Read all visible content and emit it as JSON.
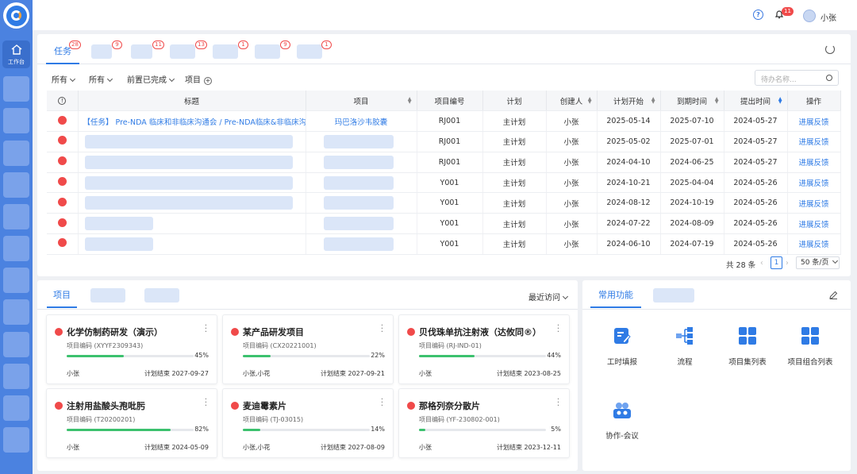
{
  "sidebar": {
    "home_label": "工作台",
    "placeholder_count": 13
  },
  "topbar": {
    "help_icon": "help-icon",
    "notification_count": "11",
    "user_name": "小张"
  },
  "tasks_panel": {
    "tabs": [
      {
        "label": "任务",
        "badge": "28"
      },
      {
        "label": "",
        "badge": "9"
      },
      {
        "label": "",
        "badge": "11"
      },
      {
        "label": "",
        "badge": "13"
      },
      {
        "label": "",
        "badge": "1"
      },
      {
        "label": "",
        "badge": "9"
      },
      {
        "label": "",
        "badge": "1"
      }
    ],
    "filters": [
      "所有",
      "所有",
      "前置已完成",
      "项目"
    ],
    "search_placeholder": "待办名称...",
    "columns": [
      "标题",
      "项目",
      "项目编号",
      "计划",
      "创建人",
      "计划开始",
      "到期时间",
      "提出时间",
      "操作"
    ],
    "rows": [
      {
        "title": "【任务】 Pre-NDA 临床和非临床沟通会 / Pre-NDA临床&非临床沟...",
        "project": "玛巴洛沙韦胶囊",
        "code": "RJ001",
        "plan": "主计划",
        "creator": "小张",
        "start": "2025-05-14",
        "due": "2025-07-10",
        "submitted": "2024-05-27",
        "action": "进展反馈"
      },
      {
        "title": "",
        "project": "",
        "code": "RJ001",
        "plan": "主计划",
        "creator": "小张",
        "start": "2025-05-02",
        "due": "2025-07-01",
        "submitted": "2024-05-27",
        "action": "进展反馈"
      },
      {
        "title": "",
        "project": "",
        "code": "RJ001",
        "plan": "主计划",
        "creator": "小张",
        "start": "2024-04-10",
        "due": "2024-06-25",
        "submitted": "2024-05-27",
        "action": "进展反馈"
      },
      {
        "title": "",
        "project": "",
        "code": "Y001",
        "plan": "主计划",
        "creator": "小张",
        "start": "2024-10-21",
        "due": "2025-04-04",
        "submitted": "2024-05-26",
        "action": "进展反馈"
      },
      {
        "title": "",
        "project": "",
        "code": "Y001",
        "plan": "主计划",
        "creator": "小张",
        "start": "2024-08-12",
        "due": "2024-10-19",
        "submitted": "2024-05-26",
        "action": "进展反馈"
      },
      {
        "title": "",
        "project": "",
        "code": "Y001",
        "plan": "主计划",
        "creator": "小张",
        "start": "2024-07-22",
        "due": "2024-08-09",
        "submitted": "2024-05-26",
        "action": "进展反馈"
      },
      {
        "title": "",
        "project": "",
        "code": "Y001",
        "plan": "主计划",
        "creator": "小张",
        "start": "2024-06-10",
        "due": "2024-07-19",
        "submitted": "2024-05-26",
        "action": "进展反馈"
      }
    ],
    "pagination": {
      "total": "共 28 条",
      "page": "1",
      "page_size": "50 条/页"
    }
  },
  "projects_panel": {
    "tab": "项目",
    "sort": "最近访问",
    "cards": [
      {
        "title": "化学仿制药研发（演示）",
        "code": "项目编码 (XYYF2309343)",
        "progress": 45,
        "pct": "45%",
        "owner": "小张",
        "end": "计划结束  2027-09-27"
      },
      {
        "title": "某产品研发项目",
        "code": "项目编码 (CX20221001)",
        "progress": 22,
        "pct": "22%",
        "owner": "小张,小花",
        "end": "计划结束  2027-09-21"
      },
      {
        "title": "贝伐珠单抗注射液（达攸同®）",
        "code": "项目编码 (RJ-IND-01)",
        "progress": 44,
        "pct": "44%",
        "owner": "小张",
        "end": "计划结束  2023-08-25"
      },
      {
        "title": "注射用盐酸头孢吡肟",
        "code": "项目编码 (T20200201)",
        "progress": 82,
        "pct": "82%",
        "owner": "小张",
        "end": "计划结束  2024-05-09"
      },
      {
        "title": "麦迪霉素片",
        "code": "项目编码 (TJ-03015)",
        "progress": 14,
        "pct": "14%",
        "owner": "小张,小花",
        "end": "计划结束  2027-08-09"
      },
      {
        "title": "那格列奈分散片",
        "code": "项目编码 (YF-230802-001)",
        "progress": 5,
        "pct": "5%",
        "owner": "小张",
        "end": "计划结束  2023-12-11"
      }
    ]
  },
  "functions_panel": {
    "tab": "常用功能",
    "items": [
      {
        "label": "工时填报",
        "icon": "timesheet-icon"
      },
      {
        "label": "流程",
        "icon": "workflow-icon"
      },
      {
        "label": "项目集列表",
        "icon": "program-list-icon"
      },
      {
        "label": "项目组合列表",
        "icon": "portfolio-list-icon"
      },
      {
        "label": "协作-会议",
        "icon": "meeting-icon"
      }
    ]
  },
  "colors": {
    "primary": "#2f7be5",
    "sidebar": "#4b82e0",
    "danger": "#f04a4a",
    "progress": "#3cc16e"
  }
}
